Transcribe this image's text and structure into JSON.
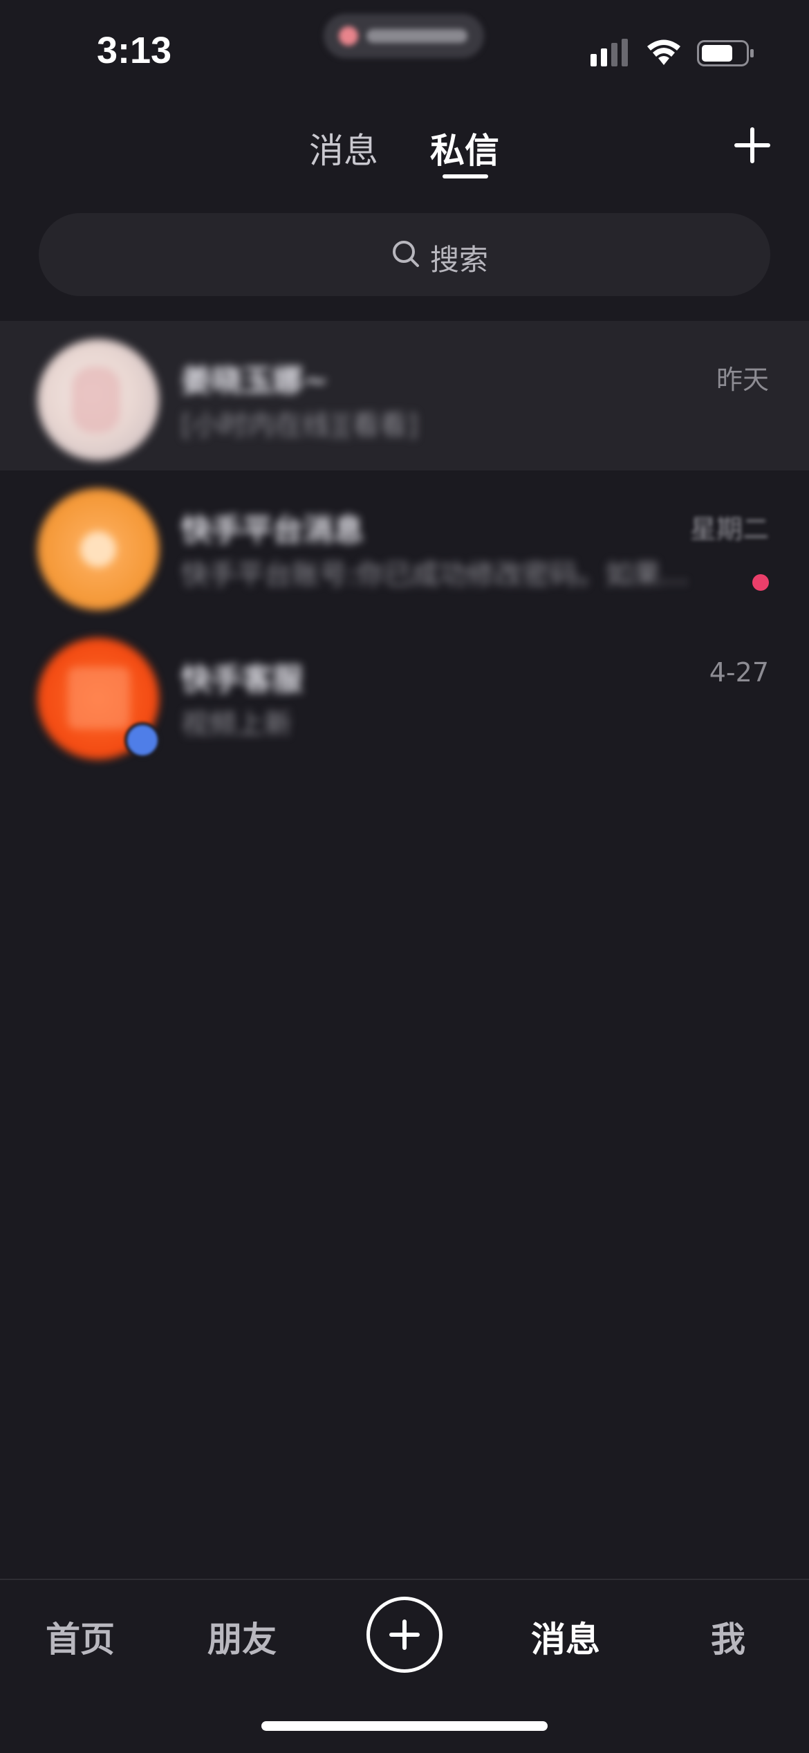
{
  "status_bar": {
    "time": "3:13"
  },
  "header": {
    "tabs": [
      {
        "label": "消息",
        "active": false
      },
      {
        "label": "私信",
        "active": true
      }
    ]
  },
  "search": {
    "label": "搜索"
  },
  "conversations": [
    {
      "name": "姜晓玉娜~",
      "preview": "[小时内在线][看看]",
      "time": "昨天",
      "unread": false,
      "avatar_color": "#e9d7d2"
    },
    {
      "name": "快手平台消息",
      "preview": "快手平台账号:你已成功修改密码。如果…",
      "time": "星期二",
      "unread": true,
      "avatar_color": "#f59a3a"
    },
    {
      "name": "快手客服",
      "preview": "视频上新",
      "time": "4-27",
      "unread": false,
      "verified": true,
      "avatar_color": "#f44d14"
    }
  ],
  "bottom_nav": {
    "items": [
      {
        "label": "首页",
        "active": false
      },
      {
        "label": "朋友",
        "active": false
      },
      {
        "label": "消息",
        "active": true
      },
      {
        "label": "我",
        "active": false
      }
    ]
  },
  "colors": {
    "background": "#1b1a20",
    "highlight_row": "#26252b",
    "unread_dot": "#ea3f6a",
    "verified_badge": "#4f7ee8"
  },
  "icons": [
    "signal-icon",
    "wifi-icon",
    "battery-icon",
    "plus-icon",
    "search-icon",
    "verified-icon",
    "create-icon"
  ]
}
